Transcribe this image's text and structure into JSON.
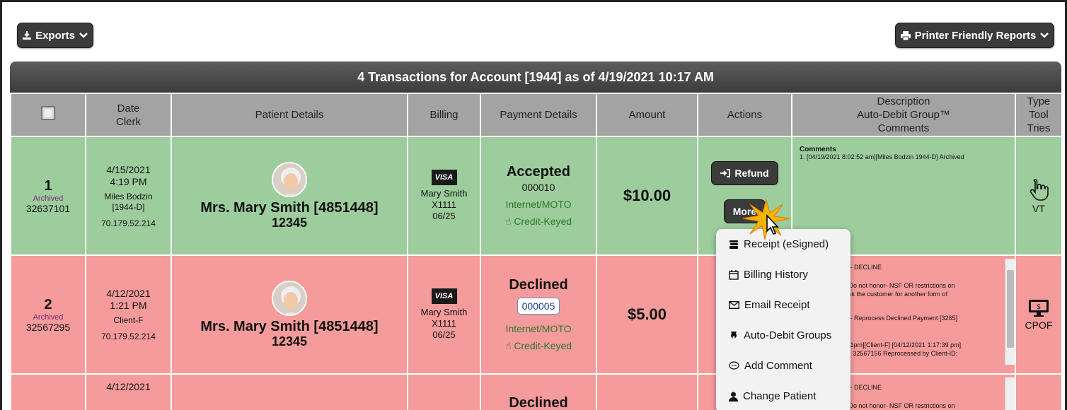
{
  "toolbar": {
    "exports_label": "Exports",
    "printer_label": "Printer Friendly Reports"
  },
  "table": {
    "title": "4 Transactions for Account [1944] as of 4/19/2021 10:17 AM",
    "headers": {
      "date_clerk": [
        "Date",
        "Clerk"
      ],
      "patient": "Patient Details",
      "billing": "Billing",
      "payment": "Payment Details",
      "amount": "Amount",
      "actions": "Actions",
      "description": [
        "Description",
        "Auto-Debit Group™",
        "Comments"
      ],
      "type": [
        "Type",
        "Tool",
        "Tries"
      ]
    },
    "rows": [
      {
        "num": "1",
        "archived": "Archived",
        "txid": "32637101",
        "date": "4/15/2021",
        "time": "4:19 PM",
        "clerk": "Miles Bodzin",
        "clerk_id": "[1944-D]",
        "ip": "70.179.52.214",
        "patient_name": "Mrs. Mary Smith [4851448]",
        "patient_zip": "12345",
        "card_brand": "VISA",
        "card_name": "Mary Smith",
        "card_num": "X1111",
        "card_exp": "06/25",
        "status": "Accepted",
        "code": "000010",
        "channel": "Internet/MOTO",
        "entry": "Credit-Keyed",
        "amount": "$10.00",
        "refund_label": "Refund",
        "more_label": "More",
        "comments_title": "Comments",
        "comments_text": "1. [04/19/2021 8:02:52 am][Miles Bodzin 1944-D] Archived",
        "type_label": "VT"
      },
      {
        "num": "2",
        "archived": "Archived",
        "txid": "32567295",
        "date": "4/12/2021",
        "time": "1:21 PM",
        "clerk": "Client-F",
        "ip": "70.179.52.214",
        "patient_name": "Mrs. Mary Smith [4851448]",
        "patient_zip": "12345",
        "card_brand": "VISA",
        "card_name": "Mary Smith",
        "card_num": "X1111",
        "card_exp": "06/25",
        "status": "Declined",
        "code": "000005",
        "channel": "Internet/MOTO",
        "entry": "Credit-Keyed",
        "amount": "$5.00",
        "comments_lines": [
          "n - DECLINE",
          "- Do not honor- NSF OR restrictions on",
          "ask the customer for another form of",
          "n - Reprocess Declined Payment [3265]",
          ":21pm][Client-F] [04/12/2021 1:17:39 pm]",
          "D: 32567156 Reprocessed by Client-ID:"
        ],
        "type_label": "CPOF"
      },
      {
        "date": "4/12/2021",
        "status": "Declined",
        "comments_lines": [
          "n - DECLINE",
          "- Do not honor- NSF OR restrictions on"
        ]
      }
    ]
  },
  "more_menu": {
    "items": [
      {
        "label": "Receipt (eSigned)",
        "icon": "receipt-icon"
      },
      {
        "label": "Billing History",
        "icon": "calendar-icon"
      },
      {
        "label": "Email Receipt",
        "icon": "envelope-icon"
      },
      {
        "label": "Auto-Debit Groups",
        "icon": "piggy-bank-icon"
      },
      {
        "label": "Add Comment",
        "icon": "comment-icon"
      },
      {
        "label": "Change Patient",
        "icon": "user-icon"
      }
    ]
  }
}
